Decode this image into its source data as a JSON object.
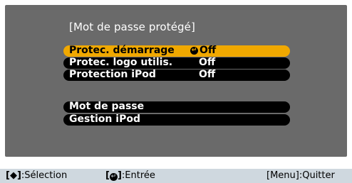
{
  "menu": {
    "title": "[Mot de passe protégé]",
    "items": [
      {
        "label": "Protec. démarrage",
        "value": "Off",
        "selected": true
      },
      {
        "label": "Protec. logo utilis.",
        "value": "Off"
      },
      {
        "label": "Protection iPod",
        "value": "Off"
      },
      {
        "label": "Mot de passe",
        "value": ""
      },
      {
        "label": "Gestion iPod",
        "value": ""
      }
    ]
  },
  "hints": {
    "select_open": "[",
    "select_symbol": "◆",
    "select_close": "]",
    "select_label": ":Sélection",
    "enter_open": "[",
    "enter_symbol": "↵",
    "enter_close": "]",
    "enter_label": ":Entrée",
    "quit": "[Menu]:Quitter"
  },
  "colors": {
    "panel_bg": "#6a6a6a",
    "selected_bg": "#f0a800",
    "row_bg": "#000000",
    "bar_bg": "#cfd8df"
  }
}
